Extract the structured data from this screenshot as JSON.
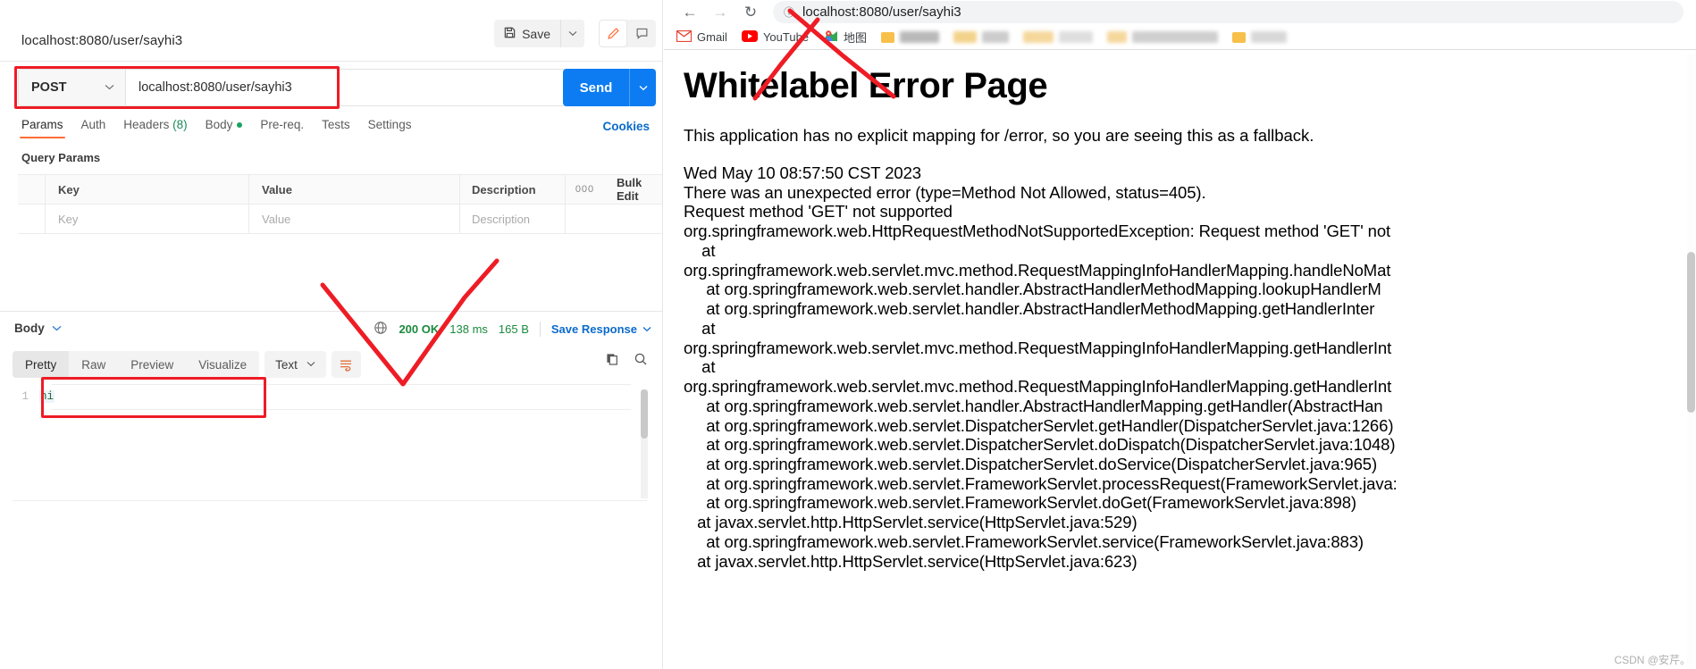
{
  "postman": {
    "request_name": "localhost:8080/user/sayhi3",
    "save_label": "Save",
    "save_caret": "chevron-down",
    "method": "POST",
    "url_value": "localhost:8080/user/sayhi3",
    "send_label": "Send",
    "tabs": [
      {
        "label": "Params",
        "active": true
      },
      {
        "label": "Auth",
        "active": false
      },
      {
        "label": "Headers",
        "count": "(8)",
        "active": false
      },
      {
        "label": "Body",
        "dot": true,
        "active": false
      },
      {
        "label": "Pre-req.",
        "active": false
      },
      {
        "label": "Tests",
        "active": false
      },
      {
        "label": "Settings",
        "active": false
      }
    ],
    "cookies_label": "Cookies",
    "query_params_title": "Query Params",
    "param_table": {
      "headers": [
        "Key",
        "Value",
        "Description"
      ],
      "dots": "000",
      "bulk_edit": "Bulk Edit",
      "rows": [
        {
          "key": "Key",
          "value": "Value",
          "description": "Description"
        }
      ]
    },
    "response": {
      "body_label": "Body",
      "status": "200 OK",
      "time": "138 ms",
      "size": "165 B",
      "save_response": "Save Response",
      "view_tabs": [
        {
          "label": "Pretty",
          "active": true
        },
        {
          "label": "Raw",
          "active": false
        },
        {
          "label": "Preview",
          "active": false
        },
        {
          "label": "Visualize",
          "active": false
        }
      ],
      "format": "Text",
      "body_lines": [
        {
          "number": "1",
          "text": "hi"
        }
      ]
    }
  },
  "browser": {
    "nav": {
      "back": "←",
      "forward": "→",
      "reload": "↻",
      "info": "ⓘ",
      "url": "localhost:8080/user/sayhi3"
    },
    "bookmarks": [
      {
        "label": "Gmail",
        "icon": "gmail-icon"
      },
      {
        "label": "YouTube",
        "icon": "youtube-icon"
      },
      {
        "label": "地图",
        "icon": "maps-icon"
      }
    ],
    "page": {
      "title": "Whitelabel Error Page",
      "description": "This application has no explicit mapping for /error, so you are seeing this as a fallback.",
      "trace": "Wed May 10 08:57:50 CST 2023\nThere was an unexpected error (type=Method Not Allowed, status=405).\nRequest method 'GET' not supported\norg.springframework.web.HttpRequestMethodNotSupportedException: Request method 'GET' not\n    at\norg.springframework.web.servlet.mvc.method.RequestMappingInfoHandlerMapping.handleNoMat\n     at org.springframework.web.servlet.handler.AbstractHandlerMethodMapping.lookupHandlerM\n     at org.springframework.web.servlet.handler.AbstractHandlerMethodMapping.getHandlerInter\n    at\norg.springframework.web.servlet.mvc.method.RequestMappingInfoHandlerMapping.getHandlerInt\n    at\norg.springframework.web.servlet.mvc.method.RequestMappingInfoHandlerMapping.getHandlerInt\n     at org.springframework.web.servlet.handler.AbstractHandlerMapping.getHandler(AbstractHan\n     at org.springframework.web.servlet.DispatcherServlet.getHandler(DispatcherServlet.java:1266)\n     at org.springframework.web.servlet.DispatcherServlet.doDispatch(DispatcherServlet.java:1048)\n     at org.springframework.web.servlet.DispatcherServlet.doService(DispatcherServlet.java:965)\n     at org.springframework.web.servlet.FrameworkServlet.processRequest(FrameworkServlet.java:\n     at org.springframework.web.servlet.FrameworkServlet.doGet(FrameworkServlet.java:898)\n   at javax.servlet.http.HttpServlet.service(HttpServlet.java:529)\n     at org.springframework.web.servlet.FrameworkServlet.service(FrameworkServlet.java:883)\n   at javax.servlet.http.HttpServlet.service(HttpServlet.java:623)"
    },
    "watermark": "CSDN @安芹。"
  },
  "annotation_color": "#ee1c25"
}
